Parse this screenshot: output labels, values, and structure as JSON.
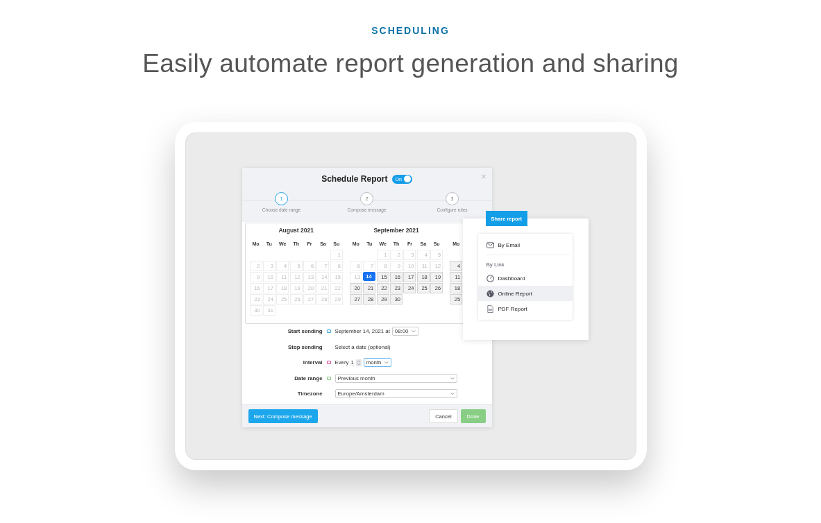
{
  "eyebrow": "SCHEDULING",
  "headline": "Easily automate report generation and sharing",
  "dialog": {
    "title": "Schedule Report",
    "toggle": {
      "label": "On",
      "on": true
    },
    "close": "×",
    "steps": [
      {
        "number": "1",
        "label": "Choose date range",
        "selected": true
      },
      {
        "number": "2",
        "label": "Compose message",
        "selected": false
      },
      {
        "number": "3",
        "label": "Configure rules",
        "selected": false
      }
    ],
    "months": [
      {
        "title": "August 2021",
        "weekdays": [
          "Mo",
          "Tu",
          "We",
          "Th",
          "Fr",
          "Sa",
          "Su"
        ],
        "weeks": [
          [
            {
              "kind": "blank"
            },
            {
              "kind": "blank"
            },
            {
              "kind": "blank"
            },
            {
              "kind": "blank"
            },
            {
              "kind": "blank"
            },
            {
              "kind": "blank"
            },
            {
              "kind": "day",
              "day": "1",
              "disabled": true,
              "selected": false
            }
          ],
          [
            {
              "day": "2",
              "disabled": true,
              "selected": false
            },
            {
              "day": "3",
              "disabled": true,
              "selected": false
            },
            {
              "day": "4",
              "disabled": true,
              "selected": false
            },
            {
              "day": "5",
              "disabled": true,
              "selected": false
            },
            {
              "day": "6",
              "disabled": true,
              "selected": false
            },
            {
              "day": "7",
              "disabled": true,
              "selected": false
            },
            {
              "day": "8",
              "disabled": true,
              "selected": false
            }
          ],
          [
            {
              "day": "9",
              "disabled": true,
              "selected": false
            },
            {
              "day": "10",
              "disabled": true,
              "selected": false
            },
            {
              "day": "11",
              "disabled": true,
              "selected": false
            },
            {
              "day": "12",
              "disabled": true,
              "selected": false
            },
            {
              "day": "13",
              "disabled": true,
              "selected": false
            },
            {
              "day": "14",
              "disabled": true,
              "selected": false
            },
            {
              "day": "15",
              "disabled": true,
              "selected": false
            }
          ],
          [
            {
              "day": "16",
              "disabled": true,
              "selected": false
            },
            {
              "day": "17",
              "disabled": true,
              "selected": false
            },
            {
              "day": "18",
              "disabled": true,
              "selected": false
            },
            {
              "day": "19",
              "disabled": true,
              "selected": false
            },
            {
              "day": "20",
              "disabled": true,
              "selected": false
            },
            {
              "day": "21",
              "disabled": true,
              "selected": false
            },
            {
              "day": "22",
              "disabled": true,
              "selected": false
            }
          ],
          [
            {
              "day": "23",
              "disabled": true,
              "selected": false
            },
            {
              "day": "24",
              "disabled": true,
              "selected": false
            },
            {
              "day": "25",
              "disabled": true,
              "selected": false
            },
            {
              "day": "26",
              "disabled": true,
              "selected": false
            },
            {
              "day": "27",
              "disabled": true,
              "selected": false
            },
            {
              "day": "28",
              "disabled": true,
              "selected": false
            },
            {
              "day": "29",
              "disabled": true,
              "selected": false
            }
          ],
          [
            {
              "day": "30",
              "disabled": true,
              "selected": false
            },
            {
              "day": "31",
              "disabled": true,
              "selected": false
            }
          ]
        ]
      },
      {
        "title": "September 2021",
        "weekdays": [
          "Mo",
          "Tu",
          "We",
          "Th",
          "Fr",
          "Sa",
          "Su"
        ],
        "weeks": [
          [
            {
              "kind": "blank"
            },
            {
              "kind": "blank"
            },
            {
              "day": "1",
              "disabled": true,
              "selected": false
            },
            {
              "day": "2",
              "disabled": true,
              "selected": false
            },
            {
              "day": "3",
              "disabled": true,
              "selected": false
            },
            {
              "day": "4",
              "disabled": true,
              "selected": false
            },
            {
              "day": "5",
              "disabled": true,
              "selected": false
            }
          ],
          [
            {
              "day": "6",
              "disabled": true,
              "selected": false
            },
            {
              "day": "7",
              "disabled": true,
              "selected": false
            },
            {
              "day": "8",
              "disabled": true,
              "selected": false
            },
            {
              "day": "9",
              "disabled": true,
              "selected": false
            },
            {
              "day": "10",
              "disabled": true,
              "selected": false
            },
            {
              "day": "11",
              "disabled": true,
              "selected": false
            },
            {
              "day": "12",
              "disabled": true,
              "selected": false
            }
          ],
          [
            {
              "day": "13",
              "disabled": true,
              "selected": false
            },
            {
              "day": "14",
              "disabled": false,
              "selected": true
            },
            {
              "day": "15",
              "disabled": false,
              "selected": false
            },
            {
              "day": "16",
              "disabled": false,
              "selected": false
            },
            {
              "day": "17",
              "disabled": false,
              "selected": false
            },
            {
              "day": "18",
              "disabled": false,
              "selected": false
            },
            {
              "day": "19",
              "disabled": false,
              "selected": false
            }
          ],
          [
            {
              "day": "20",
              "disabled": false,
              "selected": false
            },
            {
              "day": "21",
              "disabled": false,
              "selected": false
            },
            {
              "day": "22",
              "disabled": false,
              "selected": false
            },
            {
              "day": "23",
              "disabled": false,
              "selected": false
            },
            {
              "day": "24",
              "disabled": false,
              "selected": false
            },
            {
              "day": "25",
              "disabled": false,
              "selected": false
            },
            {
              "day": "26",
              "disabled": false,
              "selected": false
            }
          ],
          [
            {
              "day": "27",
              "disabled": false,
              "selected": false
            },
            {
              "day": "28",
              "disabled": false,
              "selected": false
            },
            {
              "day": "29",
              "disabled": false,
              "selected": false
            },
            {
              "day": "30",
              "disabled": false,
              "selected": false
            }
          ]
        ]
      },
      {
        "weekdays": [
          "Mo"
        ],
        "weeks": [
          [
            {
              "kind": "blank"
            }
          ],
          [
            {
              "day": "4",
              "disabled": false,
              "selected": false
            }
          ],
          [
            {
              "day": "11",
              "disabled": false,
              "selected": false
            }
          ],
          [
            {
              "day": "18",
              "disabled": false,
              "selected": false
            }
          ],
          [
            {
              "day": "25",
              "disabled": false,
              "selected": false
            }
          ]
        ]
      }
    ],
    "fields": [
      {
        "kind": "datetime",
        "label": "Start sending",
        "color": "#3aa8e0",
        "text": "September 14, 2021 at",
        "select": "08:00"
      },
      {
        "kind": "text",
        "label": "Stop sending",
        "text": "Select a date (optional)"
      },
      {
        "kind": "interval",
        "label": "Interval",
        "color": "#e0479a",
        "text": "Every",
        "value": "1",
        "select": "month"
      },
      {
        "kind": "select",
        "label": "Date range",
        "color": "#7cc576",
        "select": "Previous month"
      },
      {
        "kind": "select",
        "label": "Timezone",
        "select": "Europe/Amsterdam"
      }
    ],
    "buttons": {
      "next": "Next: Compose message",
      "cancel": "Cancel",
      "done": {
        "label": "Done",
        "disabled": true
      }
    }
  },
  "share": {
    "button": "Share report",
    "items": [
      {
        "kind": "item",
        "label": "By Email",
        "selected": false
      },
      {
        "kind": "divider"
      },
      {
        "kind": "heading",
        "label": "By Link"
      },
      {
        "kind": "item",
        "label": "Dashboard",
        "selected": false
      },
      {
        "kind": "item",
        "label": "Online Report",
        "selected": true
      },
      {
        "kind": "item",
        "label": "PDF Report",
        "selected": false
      }
    ]
  }
}
